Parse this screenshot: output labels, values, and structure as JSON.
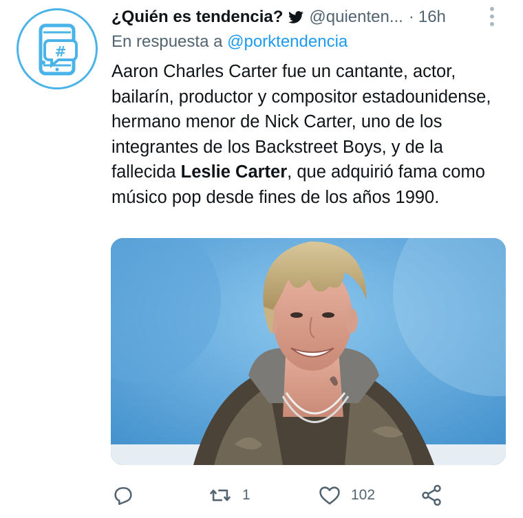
{
  "tweet": {
    "display_name": "¿Quién es tendencia?",
    "bird_icon": "twitter-bird-icon",
    "handle": "@quienten...",
    "dot": "·",
    "time": "16h",
    "reply_prefix": "En respuesta a",
    "reply_to": "@porktendencia",
    "text_part1": "Aaron Charles Carter fue un cantante, actor, bailarín, productor y compositor estadounidense, hermano menor de Nick Carter, uno de los integrantes de los Backstreet Boys, y de la fallecida ",
    "text_bold": "Leslie Carter",
    "text_part2": ", que adquirió fama como músico pop desde fines de los años 1990.",
    "media_icon": "photo-of-man-with-blonde-hair",
    "accent_color": "#1d9bf0",
    "avatar_color": "#4ab3e8"
  },
  "actions": {
    "reply_icon": "reply-icon",
    "reply_count": "",
    "retweet_icon": "retweet-icon",
    "retweet_count": "1",
    "like_icon": "heart-icon",
    "like_count": "102",
    "share_icon": "share-icon"
  }
}
